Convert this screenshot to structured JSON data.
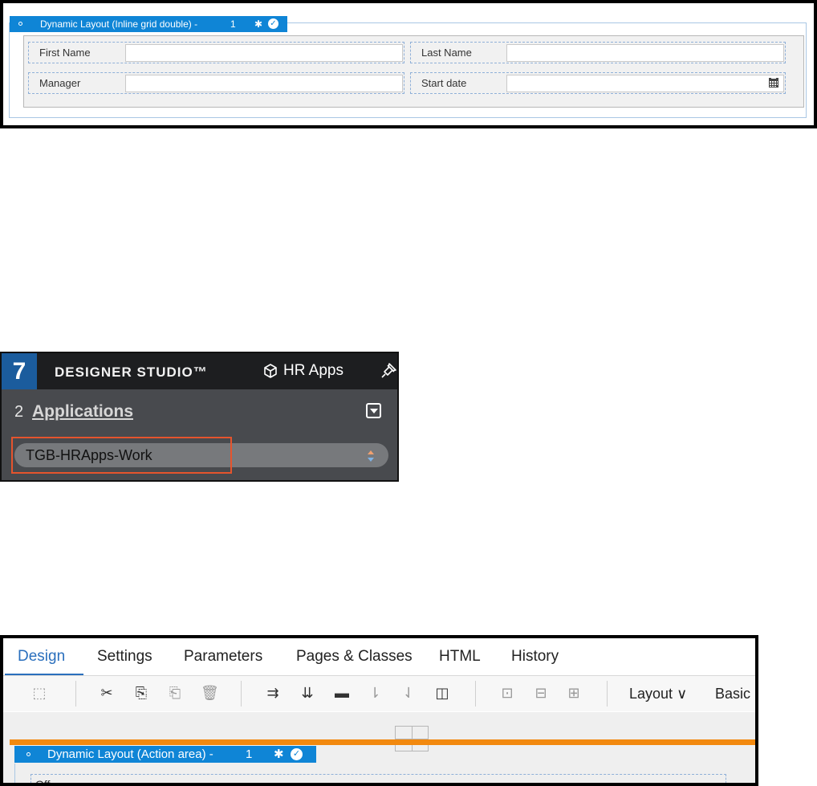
{
  "panel1": {
    "layout_header": {
      "title": "Dynamic Layout (Inline grid double) -",
      "index": "1"
    },
    "fields": [
      {
        "label": "First Name",
        "value": ""
      },
      {
        "label": "Last Name",
        "value": ""
      },
      {
        "label": "Manager",
        "value": ""
      },
      {
        "label": "Start date",
        "value": ""
      }
    ]
  },
  "panel2": {
    "logo_number": "7",
    "brand": "DESIGNER STUDIO™",
    "app_name": "HR Apps",
    "app_count": "2",
    "applications_link": "Applications",
    "class_select_value": "TGB-HRApps-Work",
    "highlight_color": "#e5542d"
  },
  "panel3": {
    "tabs": [
      "Design",
      "Settings",
      "Parameters",
      "Pages & Classes",
      "HTML",
      "History"
    ],
    "active_tab": "Design",
    "layout_menu": "Layout",
    "basic_menu": "Basic",
    "layout_header": {
      "title": "Dynamic Layout (Action area) -",
      "index": "1"
    },
    "partial_text": "Off"
  },
  "colors": {
    "accent": "#0f85d6",
    "drop_zone": "#f2890f",
    "tab_active": "#2a6fbd"
  },
  "icons": [
    "gear-icon",
    "check-icon",
    "calendar-icon",
    "cube-icon",
    "pin-icon",
    "dropdown-icon",
    "scissors-icon",
    "copy-icon",
    "paste-icon",
    "trash-icon"
  ]
}
